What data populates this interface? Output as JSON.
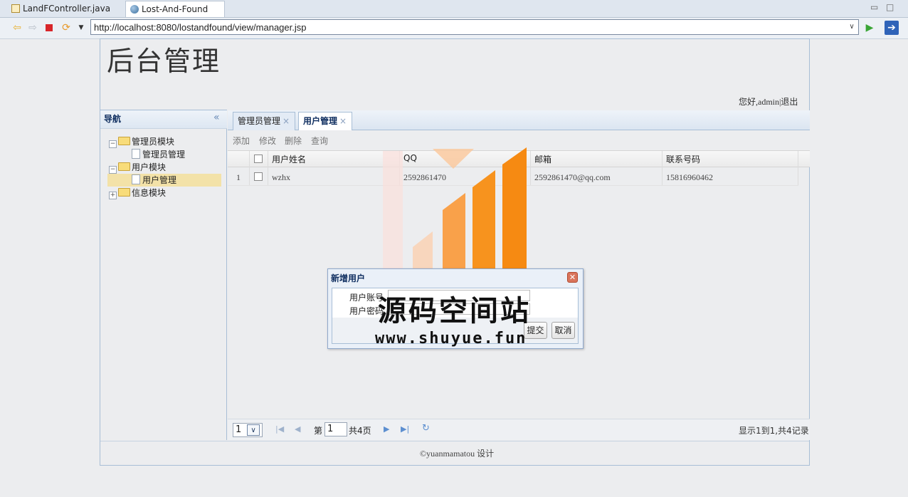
{
  "editor_tabs": [
    {
      "label": "LandFController.java",
      "icon": "java-file-icon"
    },
    {
      "label": "Lost-And-Found",
      "icon": "globe-icon",
      "close": "✕"
    }
  ],
  "url": "http://localhost:8080/lostandfound/view/manager.jsp",
  "page": {
    "title": "后台管理",
    "greeting": "您好,admin|退出"
  },
  "nav": {
    "title": "导航",
    "collapse": "«",
    "tree": [
      {
        "label": "管理员模块"
      },
      {
        "label": "管理员管理"
      },
      {
        "label": "用户模块"
      },
      {
        "label": "用户管理"
      },
      {
        "label": "信息模块"
      }
    ]
  },
  "main_tabs": [
    {
      "label": "管理员管理",
      "close": "×"
    },
    {
      "label": "用户管理",
      "close": "×"
    }
  ],
  "toolbar": {
    "add": "添加",
    "edit": "修改",
    "delete": "删除",
    "query": "查询"
  },
  "grid": {
    "columns": [
      "用户姓名",
      "QQ",
      "邮箱",
      "联系号码"
    ],
    "rows": [
      {
        "index": "1",
        "name": "wzhx",
        "qq": "2592861470",
        "email": "2592861470@qq.com",
        "phone": "15816960462"
      }
    ]
  },
  "pager": {
    "page_size": "1",
    "page_label": "第",
    "page_value": "1",
    "total_pages": "共4页",
    "info": "显示1到1,共4记录"
  },
  "footer": {
    "copyright": "©yuanmamatou 设计"
  },
  "dialog": {
    "title": "新增用户",
    "field1": "用户账号",
    "field2": "用户密码",
    "submit": "提交",
    "cancel": "取消"
  },
  "watermark": {
    "text": "源码空间站",
    "url": "www.shuyue.fun"
  },
  "colors": {
    "accent": "#0e2d5f",
    "selected_row": "#f3e2a8",
    "logo_orange": "#f7931e"
  }
}
